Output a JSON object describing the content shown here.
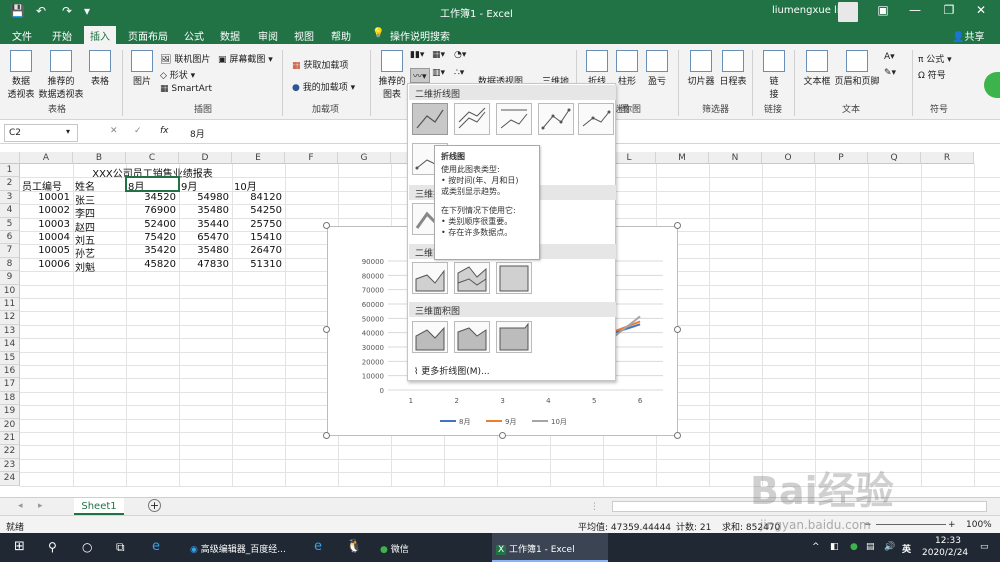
{
  "window": {
    "title": "工作簿1  -  Excel",
    "user": "liumengxue liu"
  },
  "tabs": [
    "文件",
    "开始",
    "插入",
    "页面布局",
    "公式",
    "数据",
    "审阅",
    "视图",
    "帮助",
    "操作说明搜索"
  ],
  "share_label": "共享",
  "ribbon": {
    "pivot": "数据\n透视表",
    "recommended_pivot": "推荐的\n数据透视表",
    "table": "表格",
    "group_tables": "表格",
    "picture": "图片",
    "online_pictures": "联机图片",
    "shapes": "形状",
    "smartart": "SmartArt",
    "screenshot": "屏幕截图",
    "group_illustrations": "插图",
    "get_addins": "获取加载项",
    "my_addins": "我的加载项",
    "group_addins": "加载项",
    "recommended_charts": "推荐的\n图表",
    "pivot_chart": "数据透视图",
    "three_d_map": "三维地",
    "sparkline_line": "折线",
    "sparkline_column": "柱形",
    "sparkline_winloss": "盈亏",
    "group_sparklines": "迷你图",
    "slicer": "切片器",
    "timeline": "日程表",
    "group_filters": "筛选器",
    "link": "链\n接",
    "group_links": "链接",
    "textbox": "文本框",
    "header_footer": "页眉和页脚",
    "group_text": "文本",
    "formula": "公式",
    "symbol": "符号",
    "group_symbols": "符号",
    "group_charts": "图"
  },
  "formula_bar": {
    "name_box": "C2",
    "fx": "fx",
    "value": "8月"
  },
  "columns": [
    "A",
    "B",
    "C",
    "D",
    "E",
    "F",
    "G",
    "H",
    "I",
    "J",
    "K",
    "L",
    "M",
    "N",
    "O",
    "P",
    "Q",
    "R"
  ],
  "rows": [
    "1",
    "2",
    "3",
    "4",
    "5",
    "6",
    "7",
    "8",
    "9",
    "10",
    "11",
    "12",
    "13",
    "14",
    "15",
    "16",
    "17",
    "18",
    "19",
    "20",
    "21",
    "22",
    "23",
    "24"
  ],
  "sheet": {
    "title": "XXX公司员工销售业绩报表",
    "headers": [
      "员工编号",
      "姓名",
      "8月",
      "9月",
      "10月"
    ],
    "records": [
      [
        "10001",
        "张三",
        "34520",
        "54980",
        "84120"
      ],
      [
        "10002",
        "李四",
        "76900",
        "35480",
        "54250"
      ],
      [
        "10003",
        "赵四",
        "52400",
        "35440",
        "25750"
      ],
      [
        "10004",
        "刘五",
        "75420",
        "65470",
        "15410"
      ],
      [
        "10005",
        "孙艺",
        "35420",
        "35480",
        "26470"
      ],
      [
        "10006",
        "刘魁",
        "45820",
        "47830",
        "51310"
      ]
    ]
  },
  "chart_data": {
    "type": "line",
    "x": [
      1,
      2,
      3,
      4,
      5,
      6
    ],
    "series": [
      {
        "name": "8月",
        "values": [
          34520,
          76900,
          52400,
          75420,
          35420,
          45820
        ],
        "color": "#4472c4"
      },
      {
        "name": "9月",
        "values": [
          54980,
          35480,
          35440,
          65470,
          35480,
          47830
        ],
        "color": "#ed7d31"
      },
      {
        "name": "10月",
        "values": [
          84120,
          54250,
          25750,
          15410,
          26470,
          51310
        ],
        "color": "#a5a5a5"
      }
    ],
    "y_ticks": [
      "90000",
      "80000",
      "70000",
      "60000",
      "50000",
      "40000",
      "30000",
      "20000",
      "10000",
      "0"
    ],
    "x_ticks": [
      "1",
      "2",
      "3",
      "4",
      "5",
      "6"
    ],
    "ylim": [
      0,
      90000
    ],
    "grid": true,
    "legend": "bottom"
  },
  "dropdown": {
    "sections": [
      "二维折线图",
      "三维折线图",
      "二维面积图",
      "三维面积图"
    ],
    "more": "更多折线图(M)..."
  },
  "tooltip": {
    "title": "折线图",
    "line1": "使用此图表类型:",
    "line2": "• 按时间(年、月和日)",
    "line3": "或类别显示趋势。",
    "line4": "在下列情况下使用它:",
    "line5": "• 类别顺序很重要。",
    "line6": "• 存在许多数据点。"
  },
  "sheet_tab": "Sheet1",
  "status": {
    "ready": "就绪",
    "average": "平均值: 47359.44444",
    "count": "计数: 21",
    "sum": "求和: 852470",
    "zoom": "100%"
  },
  "taskbar": {
    "item1": "高级编辑器_百度经...",
    "item2": "微信",
    "item3": "工作簿1 - Excel",
    "time": "12:33",
    "date": "2020/2/24"
  },
  "watermark": "Bai经验",
  "watermark_sub": "jingyan.baidu.com",
  "colors": {
    "excel_green": "#217346"
  }
}
